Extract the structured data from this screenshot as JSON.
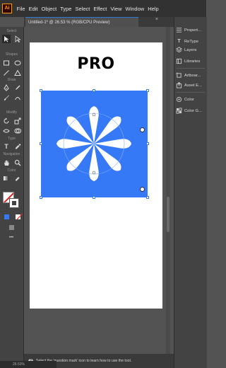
{
  "app": {
    "logo_text": "Ai"
  },
  "menu": [
    "File",
    "Edit",
    "Object",
    "Type",
    "Select",
    "Effect",
    "View",
    "Window",
    "Help"
  ],
  "document": {
    "tab_title": "Untitled-1* @ 26.53 % (RGB/CPU Preview)",
    "close_glyph": "×"
  },
  "toolbar": {
    "sections": {
      "select": "Select",
      "shapes": "Shapes",
      "draw": "Draw",
      "modify": "Modify",
      "type": "Type",
      "navigation": "Navigation",
      "color": "Color"
    },
    "more_glyph": "•••"
  },
  "artboard": {
    "title": "PRO",
    "fill_color": "#3579f6"
  },
  "right_panel": {
    "items": [
      {
        "label": "Propert...",
        "icon": "properties-icon"
      },
      {
        "label": "ReType",
        "icon": "retype-icon"
      },
      {
        "label": "Layers",
        "icon": "layers-icon"
      },
      {
        "label": "Libraries",
        "icon": "libraries-icon"
      },
      {
        "label": "Artboar...",
        "icon": "artboards-icon"
      },
      {
        "label": "Asset E...",
        "icon": "asset-export-icon"
      },
      {
        "label": "Color",
        "icon": "color-icon"
      },
      {
        "label": "Color G...",
        "icon": "color-guide-icon"
      }
    ]
  },
  "status": {
    "hint": "Select the 'question mark' icon to learn how to use the tool.",
    "help_glyph": "?"
  },
  "bottom": {
    "zoom": "26.53%"
  },
  "colors": {
    "accent": "#2f78d6",
    "chrome": "#323232",
    "panel": "#434343"
  }
}
